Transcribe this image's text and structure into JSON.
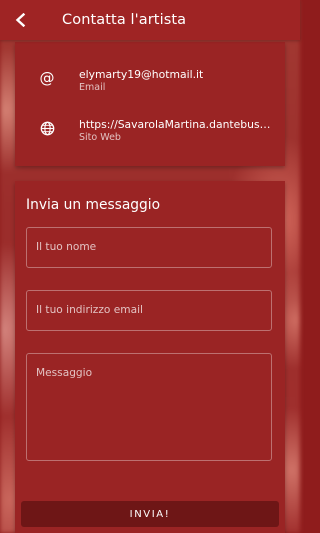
{
  "appbar": {
    "title": "Contatta l'artista",
    "back_icon": "arrow-back-icon"
  },
  "contact": {
    "email": {
      "icon": "at-sign-icon",
      "value": "elymarty19@hotmail.it",
      "label": "Email"
    },
    "website": {
      "icon": "globe-icon",
      "value": "https://SavarolaMartina.dantebus.com",
      "label": "Sito Web"
    }
  },
  "form": {
    "title": "Invia un messaggio",
    "name_placeholder": "Il tuo nome",
    "email_placeholder": "Il tuo indirizzo email",
    "message_placeholder": "Messaggio",
    "send_label": "INVIA!"
  },
  "colors": {
    "primary": "#9f2424",
    "card": "#9a2424",
    "button": "#6e1616",
    "text": "#ffffff"
  }
}
